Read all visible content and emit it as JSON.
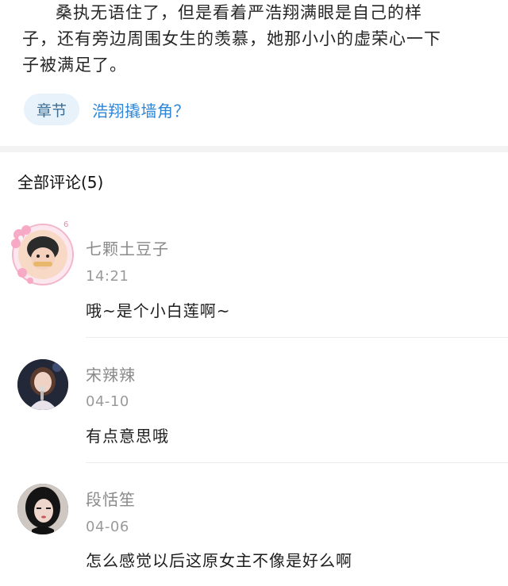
{
  "story": {
    "line1": "桑执无语住了，但是看着严浩翔满眼是自己的样",
    "line2": "子，还有旁边周围女生的羡慕，她那小小的虚荣心一下",
    "line3": "子被满足了。"
  },
  "chapter": {
    "tag_label": "章节",
    "link_label": "浩翔撬墙角？"
  },
  "comments_section": {
    "header": "全部评论(5)"
  },
  "comments": [
    {
      "name": "七颗土豆子",
      "time": "14:21",
      "text": "哦~是个小白莲啊~",
      "avatar_icon": "avatar-with-flower-frame"
    },
    {
      "name": "宋辣辣",
      "time": "04-10",
      "text": "有点意思哦",
      "avatar_icon": "avatar-girl-microphone"
    },
    {
      "name": "段恬笙",
      "time": "04-06",
      "text": "怎么感觉以后这原女主不像是好么啊",
      "avatar_icon": "avatar-girl-dark-hair"
    }
  ],
  "colors": {
    "link": "#2f86d6",
    "tag_bg": "#e8f2fb",
    "frame_pink": "#f5b8cf"
  }
}
